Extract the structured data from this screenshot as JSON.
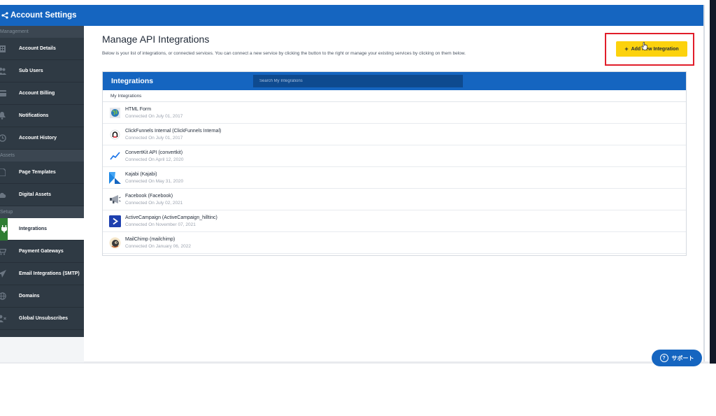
{
  "header": {
    "title": "Account Settings",
    "icon": "share-nodes-icon"
  },
  "sidebar": {
    "sections": [
      {
        "label": "Management",
        "items": [
          {
            "label": "Account Details",
            "icon": "building-icon"
          },
          {
            "label": "Sub Users",
            "icon": "users-icon"
          },
          {
            "label": "Account Billing",
            "icon": "credit-card-icon"
          },
          {
            "label": "Notifications",
            "icon": "bell-icon"
          },
          {
            "label": "Account History",
            "icon": "clock-icon"
          }
        ]
      },
      {
        "label": "Assets",
        "items": [
          {
            "label": "Page Templates",
            "icon": "file-icon"
          },
          {
            "label": "Digital Assets",
            "icon": "cloud-icon"
          }
        ]
      },
      {
        "label": "Setup",
        "items": [
          {
            "label": "Integrations",
            "icon": "plug-icon",
            "active": true
          },
          {
            "label": "Payment Gateways",
            "icon": "cart-icon"
          },
          {
            "label": "Email Integrations (SMTP)",
            "icon": "paper-plane-icon"
          },
          {
            "label": "Domains",
            "icon": "globe-icon"
          },
          {
            "label": "Global Unsubscribes",
            "icon": "user-x-icon"
          }
        ]
      }
    ]
  },
  "main": {
    "title": "Manage API Integrations",
    "description": "Below is your list of integrations, or connected services. You can connect a new service by clicking the button to the right or manage your existing services by clicking on them below.",
    "add_button": "Add New Integration"
  },
  "integrations": {
    "title": "Integrations",
    "search_placeholder": "Search My Integrations",
    "subheader": "My Integrations",
    "rows": [
      {
        "name": "HTML Form",
        "meta": "Connected On July 01, 2017",
        "icon": "globe-icon"
      },
      {
        "name": "ClickFunnels Internal (ClickFunnels Internal)",
        "meta": "Connected On July 01, 2017",
        "icon": "clickfunnels-icon"
      },
      {
        "name": "ConvertKit API (convertkit)",
        "meta": "Connected On April 12, 2020",
        "icon": "chart-line-icon"
      },
      {
        "name": "Kajabi (Kajabi)",
        "meta": "Connected On May 31, 2020",
        "icon": "kajabi-icon"
      },
      {
        "name": "Facebook (Facebook)",
        "meta": "Connected On July 02, 2021",
        "icon": "megaphone-icon"
      },
      {
        "name": "ActiveCampaign (ActiveCampaign_hilltinc)",
        "meta": "Connected On November 07, 2021",
        "icon": "activecampaign-icon"
      },
      {
        "name": "MailChimp (mailchimp)",
        "meta": "Connected On January 06, 2022",
        "icon": "mailchimp-icon"
      }
    ]
  },
  "support": {
    "label": "サポート"
  },
  "colors": {
    "brand_blue": "#1565c0",
    "sidebar_bg": "#2f3a44",
    "add_button": "#fcd20d",
    "highlight_box": "#e11d2a",
    "active_green": "#2e7d32"
  }
}
